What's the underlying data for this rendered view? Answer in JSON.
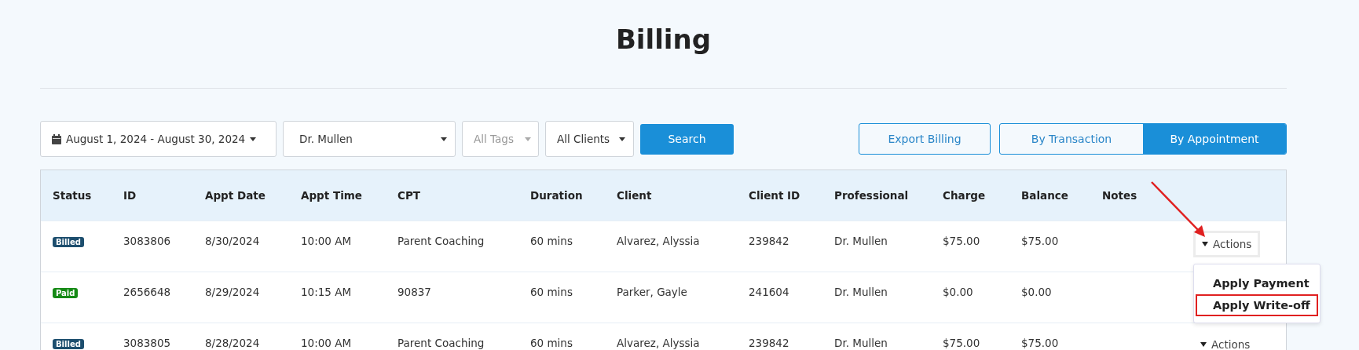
{
  "page": {
    "title": "Billing"
  },
  "filters": {
    "date_range": "August 1, 2024 - August 30, 2024",
    "professional": "Dr. Mullen",
    "tags": {
      "placeholder": "All Tags"
    },
    "clients": "All Clients",
    "search_button": "Search"
  },
  "export_button": "Export Billing",
  "view_toggle": [
    {
      "label": "By Transaction",
      "selected": false
    },
    {
      "label": "By Appointment",
      "selected": true
    }
  ],
  "table": {
    "columns": [
      "Status",
      "ID",
      "Appt Date",
      "Appt Time",
      "CPT",
      "Duration",
      "Client",
      "Client ID",
      "Professional",
      "Charge",
      "Balance",
      "Notes"
    ],
    "rows": [
      {
        "cells": [
          {
            "label": "Billed",
            "color": "#1d4e6e"
          },
          "3083806",
          "8/30/2024",
          "10:00 AM",
          "Parent Coaching",
          "60 mins",
          "Alvarez, Alyssia",
          "239842",
          "Dr. Mullen",
          "$75.00",
          "$75.00",
          ""
        ],
        "actions": "Actions",
        "menu_open": true
      },
      {
        "cells": [
          {
            "label": "Paid",
            "color": "#168a16"
          },
          "2656648",
          "8/29/2024",
          "10:15 AM",
          "90837",
          "60 mins",
          "Parker, Gayle",
          "241604",
          "Dr. Mullen",
          "$0.00",
          "$0.00",
          ""
        ],
        "menu_open": false
      },
      {
        "cells": [
          {
            "label": "Billed",
            "color": "#1d4e6e"
          },
          "3083805",
          "8/28/2024",
          "10:00 AM",
          "Parent Coaching",
          "60 mins",
          "Alvarez, Alyssia",
          "239842",
          "Dr. Mullen",
          "$75.00",
          "$75.00",
          ""
        ],
        "actions": "Actions",
        "menu_open": false
      }
    ]
  },
  "actions_menu": [
    {
      "label": "Apply Payment",
      "highlighted": false
    },
    {
      "label": "Apply Write-off",
      "highlighted": true
    }
  ]
}
